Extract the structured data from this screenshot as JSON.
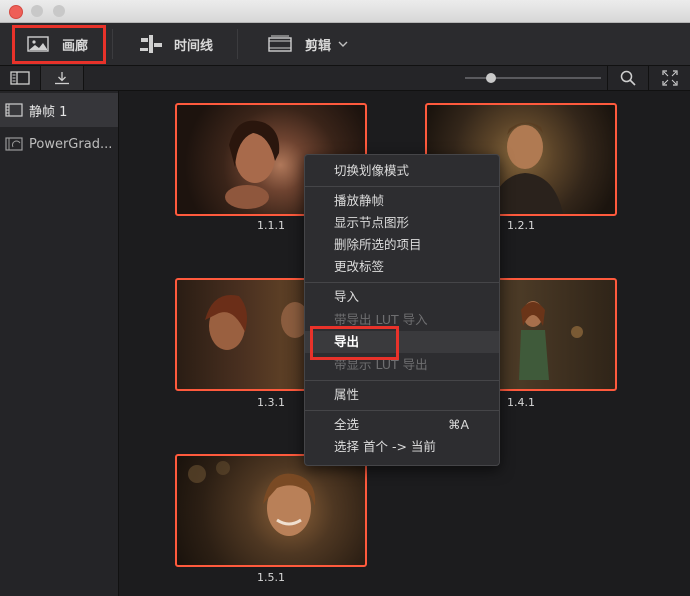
{
  "toolbar": {
    "gallery_label": "画廊",
    "timeline_label": "时间线",
    "clips_label": "剪辑"
  },
  "sidebar": {
    "items": [
      {
        "label": "静帧 1",
        "icon": "still-album-icon",
        "selected": true
      },
      {
        "label": "PowerGrad...",
        "icon": "powergrade-album-icon",
        "selected": false
      }
    ]
  },
  "stills": [
    {
      "label": "1.1.1"
    },
    {
      "label": "1.2.1"
    },
    {
      "label": "1.3.1"
    },
    {
      "label": "1.4.1"
    },
    {
      "label": "1.5.1"
    }
  ],
  "context_menu": {
    "items": [
      {
        "label": "切换划像模式"
      },
      {
        "label": "播放静帧"
      },
      {
        "label": "显示节点图形"
      },
      {
        "label": "删除所选的项目"
      },
      {
        "label": "更改标签"
      },
      {
        "label": "导入"
      },
      {
        "label": "带导出 LUT 导入"
      },
      {
        "label": "导出"
      },
      {
        "label": "带显示 LUT 导出"
      },
      {
        "label": "属性"
      },
      {
        "label": "全选",
        "shortcut": "⌘A"
      },
      {
        "label": "选择 首个 -> 当前"
      }
    ]
  },
  "zoom_slider": {
    "value": 0.2
  },
  "colors": {
    "highlight_box": "#e8322a",
    "thumb_border": "#ff5a3d",
    "background": "#1d1d1f"
  }
}
